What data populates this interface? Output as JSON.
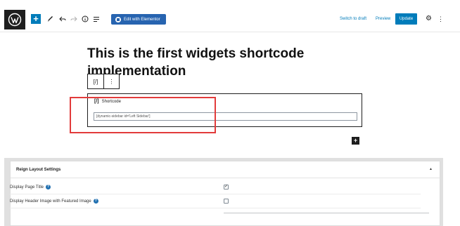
{
  "toolbar": {
    "logo_icon": "wordpress-logo-icon",
    "add_label": "+",
    "elementor_label": "Edit with Elementor",
    "switch_draft_label": "Switch to draft",
    "preview_label": "Preview",
    "update_label": "Update",
    "accent_color": "#007cba",
    "elementor_color": "#2764b0"
  },
  "editor": {
    "title": "This is the first widgets shortcode implementation",
    "block_toolbar": {
      "shortcode_icon_label": "[/]",
      "more_icon_label": "⋮"
    },
    "shortcode_block": {
      "icon_label": "[/]",
      "label": "Shortcode",
      "value": "[dynamic-sidebar id='Left Sidebar']"
    },
    "inserter_label": "+",
    "highlight_color": "#e23b3b"
  },
  "metabox": {
    "title": "Reign Layout Settings",
    "collapse_icon": "▲",
    "rows": [
      {
        "label": "Display Page Title",
        "help": "?",
        "checked": true,
        "check_glyph": "✓"
      },
      {
        "label": "Display Header Image with Featured Image",
        "help": "?",
        "checked": false,
        "check_glyph": ""
      }
    ]
  }
}
